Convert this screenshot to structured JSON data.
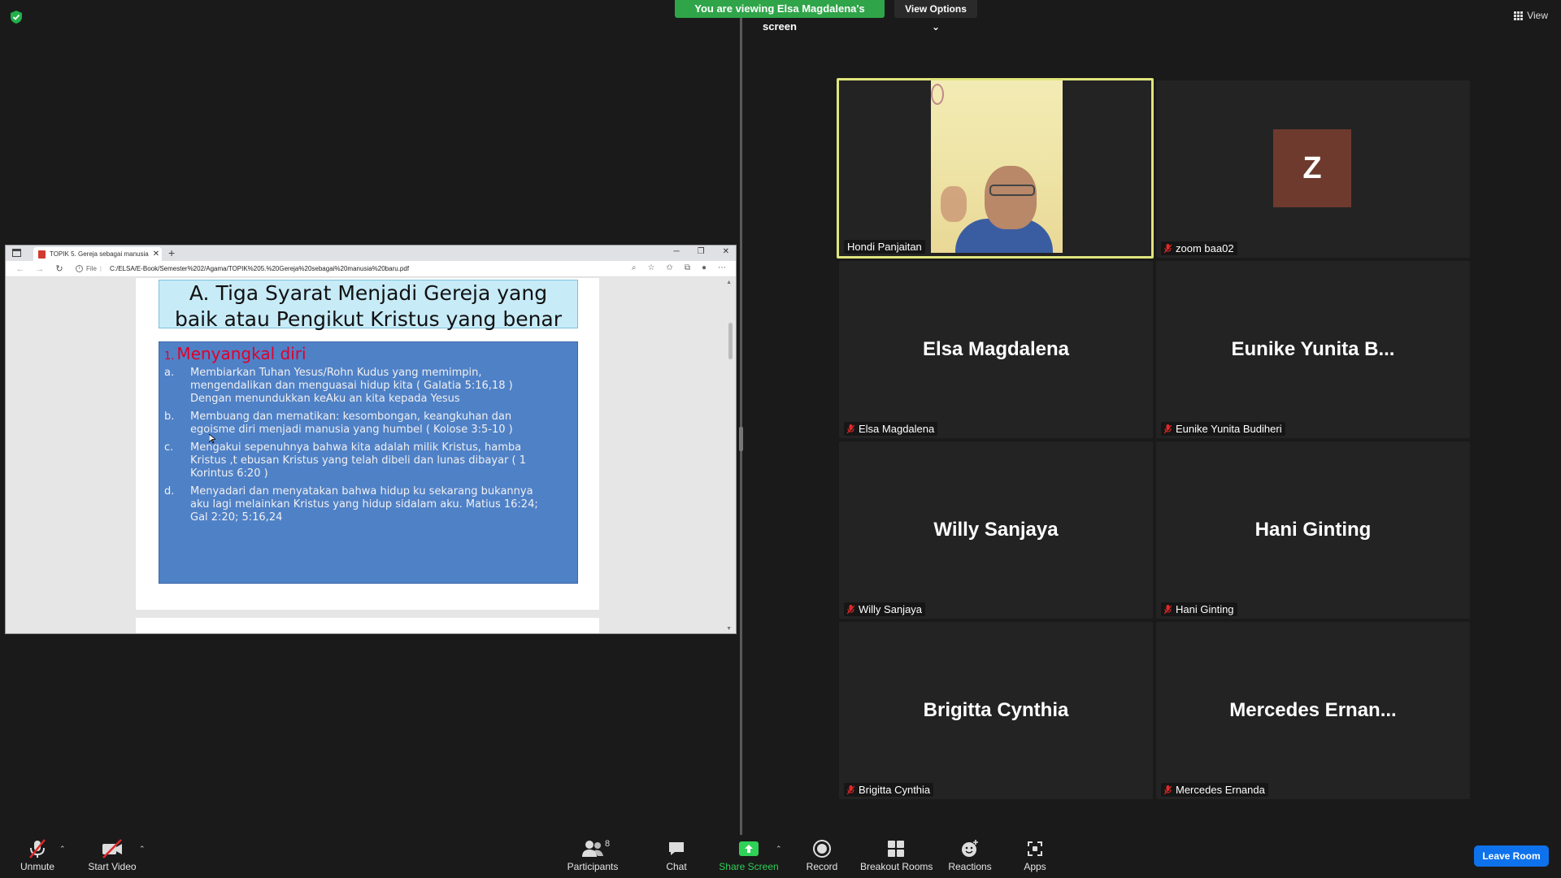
{
  "meeting": {
    "share_banner": "You are viewing Elsa Magdalena's screen",
    "view_options": "View Options",
    "view_label": "View",
    "leave_label": "Leave Room"
  },
  "browser": {
    "tab_title": "TOPIK 5. Gereja sebagai manusia",
    "file_label": "File",
    "url": "C:/ELSA/E-Book/Semester%202/Agama/TOPIK%205.%20Gereja%20sebagai%20manusia%20baru.pdf"
  },
  "slide": {
    "title_line1": "A. Tiga Syarat Menjadi Gereja yang",
    "title_line2": "baik atau Pengikut Kristus yang benar",
    "heading_num": "1.",
    "heading": "Menyangkal diri",
    "items": [
      {
        "key": "a.",
        "line1": "Membiarkan Tuhan Yesus/Rohn Kudus yang memimpin,",
        "line2": "mengendalikan dan menguasai hidup kita ( Galatia 5:16,18 )",
        "line3": "Dengan menundukkan keAku an kita kepada Yesus"
      },
      {
        "key": "b.",
        "line1": "Membuang dan mematikan:  kesombongan, keangkuhan dan",
        "line2": "egoisme diri menjadi manusia yang humbel ( Kolose 3:5-10 )",
        "line3": ""
      },
      {
        "key": "c.",
        "line1": "Mengakui sepenuhnya bahwa kita adalah milik Kristus, hamba",
        "line2": "Kristus ,t ebusan Kristus  yang telah dibeli dan lunas dibayar ( 1",
        "line3": "Korintus 6:20 )"
      },
      {
        "key": "d.",
        "line1": "Menyadari dan menyatakan bahwa hidup ku sekarang bukannya",
        "line2": "aku lagi melainkan Kristus yang hidup sidalam aku. Matius 16:24;",
        "line3": "Gal 2:20; 5:16,24"
      }
    ]
  },
  "participants": [
    {
      "label": "Hondi Panjaitan",
      "big": "",
      "video": true
    },
    {
      "label": "zoom baa02",
      "big": "",
      "avatar": "Z"
    },
    {
      "label": "Elsa Magdalena",
      "big": "Elsa Magdalena"
    },
    {
      "label": "Eunike Yunita Budiheri",
      "big": "Eunike Yunita B..."
    },
    {
      "label": "Willy Sanjaya",
      "big": "Willy Sanjaya"
    },
    {
      "label": "Hani Ginting",
      "big": "Hani Ginting"
    },
    {
      "label": "Brigitta Cynthia",
      "big": "Brigitta Cynthia"
    },
    {
      "label": "Mercedes Ernanda",
      "big": "Mercedes  Ernan..."
    }
  ],
  "toolbar": {
    "unmute": "Unmute",
    "start_video": "Start Video",
    "participants": "Participants",
    "participants_count": "8",
    "chat": "Chat",
    "share_screen": "Share Screen",
    "record": "Record",
    "breakout_rooms": "Breakout Rooms",
    "reactions": "Reactions",
    "apps": "Apps"
  },
  "colors": {
    "share_green": "#2fa449",
    "leave_blue": "#0e72ed",
    "active_speaker_border": "#e0e57c",
    "slide_blue": "#4f81c7",
    "slide_heading_red": "#e0002a"
  }
}
